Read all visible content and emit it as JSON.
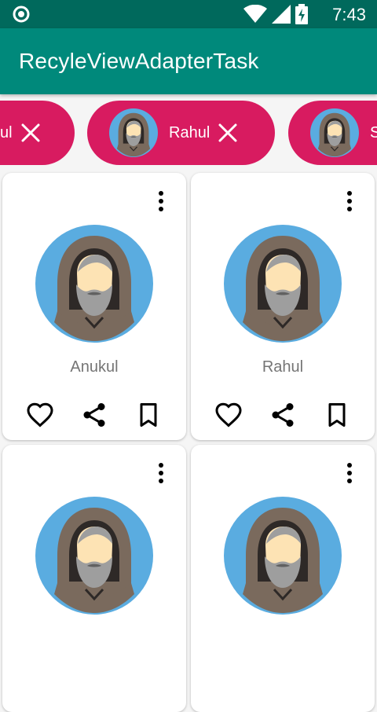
{
  "status_bar": {
    "time": "7:43",
    "icons": [
      "ring-icon",
      "wifi-icon",
      "signal-icon",
      "battery-charging-icon"
    ]
  },
  "app_bar": {
    "title": "RecyleViewAdapterTask",
    "color": "#00897b",
    "status_color": "#00695c"
  },
  "chips": [
    {
      "label": "ul",
      "close_icon": "close-icon"
    },
    {
      "label": "Rahul",
      "close_icon": "close-icon",
      "avatar_icon": "hooded-avatar-icon"
    },
    {
      "label": "S",
      "avatar_icon": "hooded-avatar-icon"
    }
  ],
  "chip_color": "#d81b60",
  "cards": [
    {
      "name": "Anukul",
      "avatar_icon": "hooded-avatar-icon",
      "actions": [
        "heart-icon",
        "share-icon",
        "bookmark-icon"
      ],
      "menu_icon": "more-vert-icon"
    },
    {
      "name": "Rahul",
      "avatar_icon": "hooded-avatar-icon",
      "actions": [
        "heart-icon",
        "share-icon",
        "bookmark-icon"
      ],
      "menu_icon": "more-vert-icon"
    },
    {
      "name": "",
      "avatar_icon": "hooded-avatar-icon",
      "menu_icon": "more-vert-icon"
    },
    {
      "name": "",
      "avatar_icon": "hooded-avatar-icon",
      "menu_icon": "more-vert-icon"
    }
  ]
}
